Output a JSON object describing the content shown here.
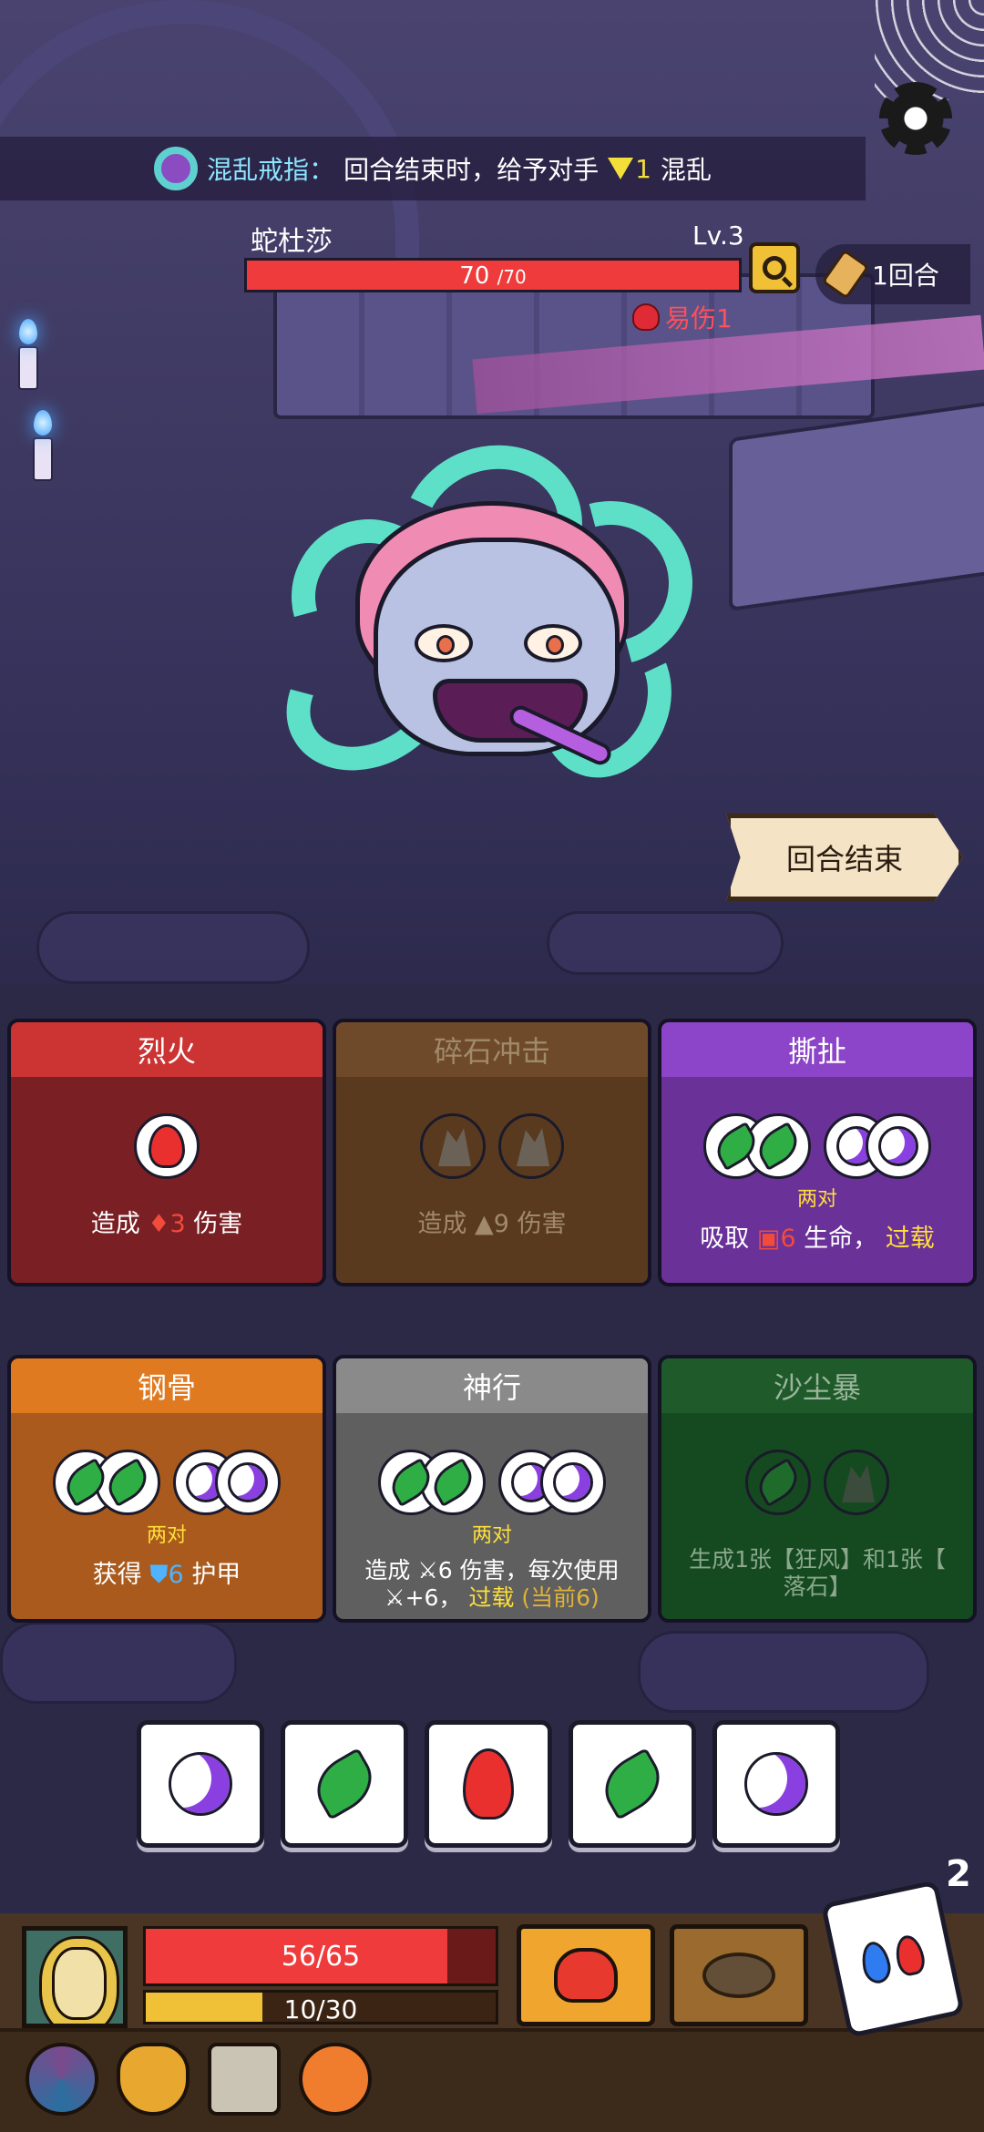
{
  "top_bar": {
    "relic_name": "混乱戒指",
    "colon": "：",
    "desc_prefix": "回合结束时，给予对手",
    "status_amount": "1",
    "status_name": "混乱"
  },
  "enemy": {
    "name": "蛇杜莎",
    "level": "Lv.3",
    "hp_current": "70",
    "hp_max": "/70",
    "hp_fraction": 1.0,
    "status": "易伤1"
  },
  "round": {
    "label": "1回合"
  },
  "end_turn_label": "回合结束",
  "cards": [
    {
      "title": "烈火",
      "head_color": "#cc3333",
      "body_color": "#7a1f24",
      "desc_pre": "造成",
      "desc_num": "3",
      "desc_post": "伤害"
    },
    {
      "title": "碎石冲击",
      "head_color": "#6e4a2a",
      "body_color": "#5a3a1e",
      "desc_pre": "造成",
      "desc_num": "9",
      "desc_post": "伤害"
    },
    {
      "title": "撕扯",
      "head_color": "#8c44c8",
      "body_color": "#6a3198",
      "pair_label": "两对",
      "desc_pre": "吸取",
      "desc_num": "6",
      "desc_mid": "生命，",
      "desc_tag": "过载"
    },
    {
      "title": "钢骨",
      "head_color": "#e07a20",
      "body_color": "#a95a1c",
      "pair_label": "两对",
      "desc_pre": "获得",
      "desc_num": "6",
      "desc_post": "护甲"
    },
    {
      "title": "神行",
      "head_color": "#8a8a8a",
      "body_color": "#5f5f5f",
      "pair_label": "两对",
      "desc_line1": "造成",
      "desc_num": "6",
      "desc_line1_post": "伤害，每次使用",
      "desc_line2_pre": "+6，",
      "desc_tag": "过载",
      "desc_current": "(当前6)"
    },
    {
      "title": "沙尘暴",
      "head_color": "#1f5a2a",
      "body_color": "#154a20",
      "desc_line1": "生成1张【狂风】和1张【",
      "desc_line2": "落石】"
    }
  ],
  "dice_tray": [
    "moon-icon",
    "leaf-icon",
    "fire-icon",
    "leaf-icon",
    "moon-icon"
  ],
  "player": {
    "hp_text": "56/65",
    "hp_fraction": 0.8615,
    "xp_text": "10/30",
    "xp_fraction": 0.3333
  },
  "roll_count": "2"
}
